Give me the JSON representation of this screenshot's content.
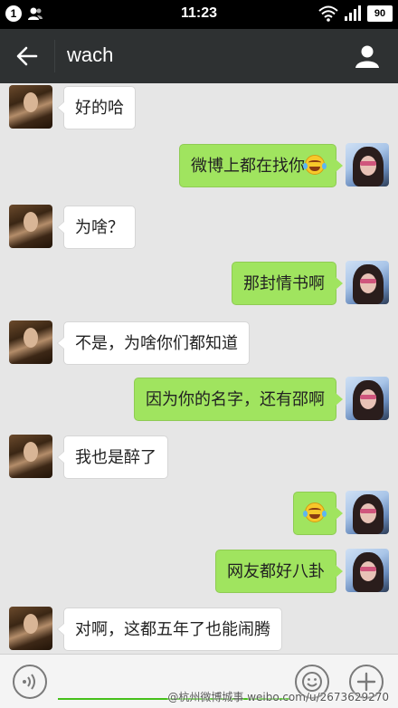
{
  "status_bar": {
    "notification_count": "1",
    "time": "11:23",
    "battery": "90",
    "icons": [
      "notification-badge-icon",
      "contacts-icon",
      "wifi-icon",
      "signal-icon",
      "battery-icon"
    ]
  },
  "header": {
    "title": "wach",
    "back_icon": "arrow-left-icon",
    "profile_icon": "person-icon"
  },
  "messages": [
    {
      "side": "left",
      "text": "好的哈",
      "emoji": false
    },
    {
      "side": "right",
      "text": "微博上都在找你",
      "emoji": true
    },
    {
      "side": "left",
      "text": "为啥？",
      "emoji": false
    },
    {
      "side": "right",
      "text": "那封情书啊",
      "emoji": false
    },
    {
      "side": "left",
      "text": "不是，为啥你们都知道",
      "emoji": false
    },
    {
      "side": "right",
      "text": "因为你的名字，还有邵啊",
      "emoji": false
    },
    {
      "side": "left",
      "text": "我也是醉了",
      "emoji": false
    },
    {
      "side": "right",
      "text": "",
      "emoji": true
    },
    {
      "side": "right",
      "text": "网友都好八卦",
      "emoji": false
    },
    {
      "side": "left",
      "text": "对啊，这都五年了也能闹腾",
      "emoji": false
    }
  ],
  "input_bar": {
    "placeholder": "",
    "voice_icon": "voice-icon",
    "emoji_icon": "emoji-icon",
    "plus_icon": "plus-icon"
  },
  "watermark": "@杭州微博城事 weibo.com/u/2673629270",
  "colors": {
    "header_bg": "#2e3132",
    "chat_bg": "#e6e6e6",
    "sent_bubble": "#a0e45f",
    "received_bubble": "#ffffff",
    "input_accent": "#45c01a"
  }
}
